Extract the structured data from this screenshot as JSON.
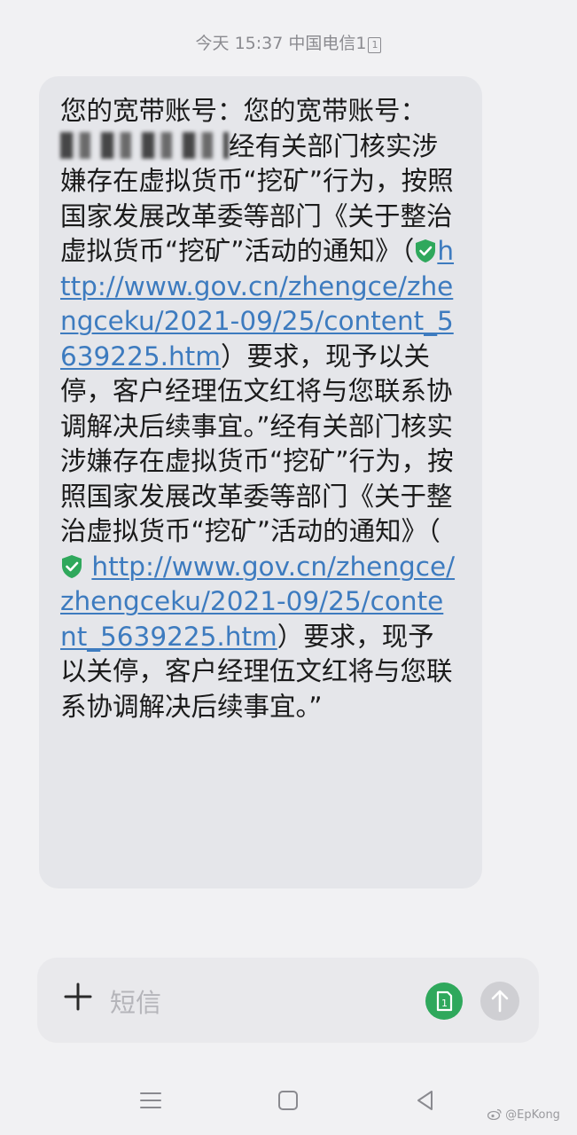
{
  "status": {
    "day": "今天",
    "time": "15:37",
    "carrier": "中国电信1",
    "sim_badge": "1"
  },
  "message": {
    "p1": "您的宽带账号：您的宽带账号：",
    "p2": "经有关部门核实涉嫌存在虚拟货币“挖矿”行为，按照国家发展改革委等部门《关于整治虚拟货币“挖矿”活动的通知》（",
    "link1": "http://www.gov.cn/zhengce/zhengceku/2021-09/25/content_5639225.htm",
    "p3": "）要求，现予以关停，客户经理伍文红将与您联系协调解决后续事宜。”经有关部门核实涉嫌存在虚拟货币“挖矿”行为，按照国家发展改革委等部门《关于整治虚拟货币“挖矿”活动的通知》（",
    "link2": "http://www.gov.cn/zhengce/zhengceku/2021-09/25/content_5639225.htm",
    "link2_display": "http://www.gov.cn/zhengce/zhengceku/2021-09/25/content_5639225.htm",
    "p4": "）要求，现予以关停，客户经理伍文红将与您联系协调解决后续事宜。”"
  },
  "input": {
    "placeholder": "短信",
    "sim_label": "1"
  },
  "icons": {
    "shield": "verified-shield-icon",
    "plus": "plus-icon",
    "send": "send-arrow-icon",
    "sim": "sim-card-icon",
    "nav_menu": "menu-icon",
    "nav_home": "home-icon",
    "nav_back": "back-icon"
  },
  "colors": {
    "link": "#3d7bbf",
    "shield": "#2fa85c",
    "sim_button": "#2fa85c",
    "send_button": "#cfcfd3",
    "bubble": "#e5e6ea"
  },
  "watermark": "@EpKong"
}
